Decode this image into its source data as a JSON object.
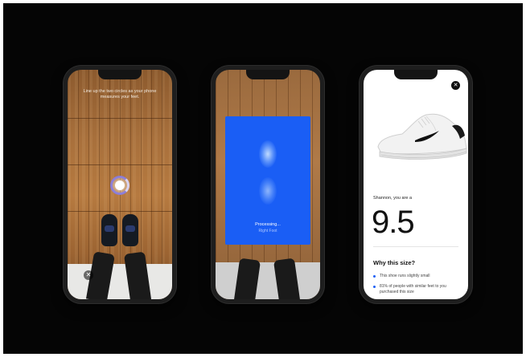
{
  "phone1": {
    "instruction": "Line up the two circles as your phone measures your feet.",
    "close_glyph": "✕"
  },
  "phone2": {
    "status": "Processing...",
    "substatus": "Right Foot"
  },
  "phone3": {
    "close_glyph": "✕",
    "greeting": "Shannon, you are a",
    "size": "9.5",
    "why_heading": "Why this size?",
    "bullets": [
      "This shoe runs slightly small",
      "81% of people with similar feet to you purchased this size"
    ]
  },
  "icons": {
    "close": "close-icon",
    "scan_target": "scan-target-icon"
  },
  "colors": {
    "brand_blue": "#1a5ef5",
    "background": "#050505",
    "scan_ring": "#8a7bd6"
  }
}
